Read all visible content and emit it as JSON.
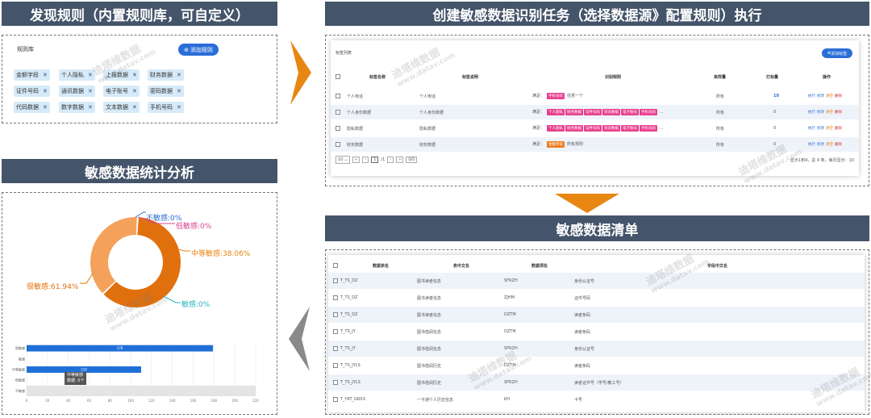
{
  "headers": {
    "top_left": "发现规则（内置规则库，可自定义）",
    "top_right": "创建敏感数据识别任务（选择数据源》配置规则）执行",
    "mid_left": "敏感数据统计分析",
    "mid_right": "敏感数据清单"
  },
  "rule_library": {
    "title": "规则库",
    "add_button": "添加规则",
    "tags": [
      "金额字段",
      "个人隐私",
      "上报数据",
      "财务数据",
      "证件号码",
      "通讯数据",
      "电子账号",
      "密码数据",
      "代码数据",
      "数字数据",
      "文本数据",
      "手机号码"
    ]
  },
  "task_list": {
    "title": "标签列表",
    "add_button": "添加标签",
    "columns": [
      "标签名称",
      "标签说明",
      "识别规则",
      "来样量",
      "打标量",
      "操作"
    ],
    "rows": [
      {
        "name": "个人电话",
        "desc": "个人电话",
        "prefix": "满足：",
        "rules": [
          "手机号码"
        ],
        "rule_text": "任意一个",
        "sample": "所有",
        "count": "10"
      },
      {
        "name": "个人身份数据",
        "desc": "个人身份数据",
        "prefix": "满足：",
        "rules": [
          "个人隐私",
          "财务数据",
          "证件号码",
          "资讯数据",
          "电子账号",
          "手机号码"
        ],
        "rule_text": "...",
        "sample": "所有",
        "count": "0"
      },
      {
        "name": "隐私数据",
        "desc": "隐私数据",
        "prefix": "满足：",
        "rules": [
          "个人隐私",
          "财务数据",
          "证件号码",
          "资讯数据",
          "电子账号",
          "手机号码"
        ],
        "rule_text": "...",
        "sample": "所有",
        "count": "0"
      },
      {
        "name": "财务数据",
        "desc": "财务数据",
        "prefix": "满足：",
        "rules": [
          "金额字段"
        ],
        "rule_text": "所有规则",
        "sample": "所有",
        "count": "0"
      }
    ],
    "actions": [
      "执行",
      "修改",
      "清空",
      "删除"
    ],
    "pagination": {
      "page_size": "10",
      "page": "1",
      "total_pages": "/1",
      "go": "GO",
      "summary": "显示1到4，总 4 条，每页显示：10"
    }
  },
  "donut": {
    "labels": {
      "none": "不敏感:0%",
      "low": "低敏感:0%",
      "mid": "中等敏感:38.06%",
      "high": "很敏感:61.94%",
      "sens": "敏感:0%"
    }
  },
  "bar_chart": {
    "type": "bar",
    "categories": [
      "很敏感",
      "敏感",
      "中等敏感",
      "低敏感",
      "不敏感"
    ],
    "values": [
      179,
      0,
      110,
      0,
      0
    ],
    "xticks": [
      "0",
      "20",
      "40",
      "60",
      "80",
      "100",
      "120",
      "140",
      "160",
      "180",
      "200",
      "220"
    ],
    "tooltip_title": "中等敏感",
    "tooltip_value": "数据: 0个"
  },
  "chart_data": {
    "type": "pie",
    "categories": [
      "很敏感",
      "中等敏感",
      "敏感",
      "低敏感",
      "不敏感"
    ],
    "values": [
      61.94,
      38.06,
      0,
      0,
      0
    ],
    "colors": [
      "#e0700e",
      "#f4a15c",
      "#2cb5c0",
      "#d9438f",
      "#2a6ed8"
    ]
  },
  "inventory": {
    "columns": [
      "数据表名",
      "表中文名",
      "数据项名",
      "字段中文名"
    ],
    "rows": [
      {
        "table": "T_TS_DZ",
        "cn": "图书读者信息",
        "field": "SFRZH",
        "field_cn": "身份认证号"
      },
      {
        "table": "T_TS_DZ",
        "cn": "图书读者信息",
        "field": "ZJHM",
        "field_cn": "证件号码"
      },
      {
        "table": "T_TS_DZ",
        "cn": "图书读者信息",
        "field": "DZTM",
        "field_cn": "读者条码"
      },
      {
        "table": "T_TS_JY",
        "cn": "图书借阅信息",
        "field": "DZTM",
        "field_cn": "读者条码"
      },
      {
        "table": "T_TS_JY",
        "cn": "图书借阅信息",
        "field": "SFRZH",
        "field_cn": "身份认证号"
      },
      {
        "table": "T_TS_JYLS",
        "cn": "图书借阅历史",
        "field": "DZTM",
        "field_cn": "读者条码"
      },
      {
        "table": "T_TS_JYLS",
        "cn": "图书借阅历史",
        "field": "SFRZH",
        "field_cn": "读者证件号（学号/教工号）"
      },
      {
        "table": "T_YKT_GRXX",
        "cn": "一卡通个人历史信息",
        "field": "KH",
        "field_cn": "卡号"
      }
    ]
  },
  "watermark": {
    "cn": "迪塔维数据",
    "en": "www.datav.com"
  }
}
